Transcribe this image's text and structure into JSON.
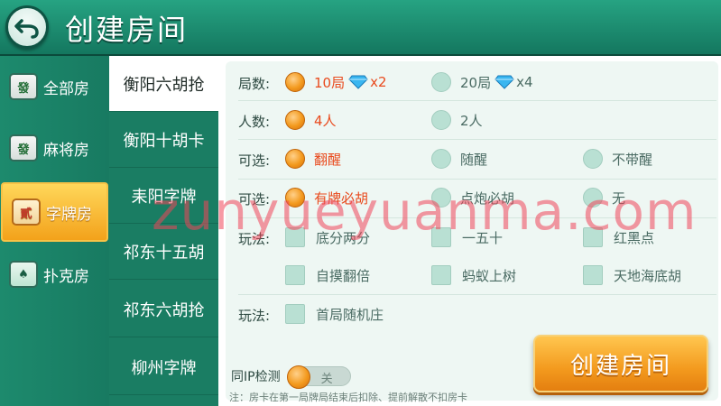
{
  "header": {
    "title": "创建房间"
  },
  "sidebar": {
    "items": [
      {
        "label": "全部房",
        "icon": "mahjong-tile-icon",
        "active": false
      },
      {
        "label": "麻将房",
        "icon": "mahjong-tile-icon",
        "active": false
      },
      {
        "label": "字牌房",
        "icon": "zipai-cards-icon",
        "active": true
      },
      {
        "label": "扑克房",
        "icon": "poker-cards-icon",
        "active": false
      }
    ]
  },
  "subtabs": [
    {
      "label": "衡阳六胡抢",
      "active": true
    },
    {
      "label": "衡阳十胡卡",
      "active": false
    },
    {
      "label": "耒阳字牌",
      "active": false
    },
    {
      "label": "祁东十五胡",
      "active": false
    },
    {
      "label": "祁东六胡抢",
      "active": false
    },
    {
      "label": "柳州字牌",
      "active": false
    }
  ],
  "options": {
    "rounds": {
      "label": "局数:",
      "choices": [
        {
          "text": "10局",
          "mult": "x2",
          "selected": true
        },
        {
          "text": "20局",
          "mult": "x4",
          "selected": false
        }
      ]
    },
    "players": {
      "label": "人数:",
      "choices": [
        {
          "text": "4人",
          "selected": true
        },
        {
          "text": "2人",
          "selected": false
        }
      ]
    },
    "optional1": {
      "label": "可选:",
      "choices": [
        {
          "text": "翻醒",
          "selected": true
        },
        {
          "text": "随醒",
          "selected": false
        },
        {
          "text": "不带醒",
          "selected": false
        }
      ]
    },
    "optional2": {
      "label": "可选:",
      "choices": [
        {
          "text": "有牌必胡",
          "selected": true
        },
        {
          "text": "点炮必胡",
          "selected": false
        },
        {
          "text": "无",
          "selected": false
        }
      ]
    },
    "play1": {
      "label": "玩法:",
      "choices": [
        {
          "text": "底分两分",
          "checked": false
        },
        {
          "text": "一五十",
          "checked": false
        },
        {
          "text": "红黑点",
          "checked": false
        },
        {
          "text": "自摸翻倍",
          "checked": false
        },
        {
          "text": "蚂蚁上树",
          "checked": false
        },
        {
          "text": "天地海底胡",
          "checked": false
        }
      ]
    },
    "play2": {
      "label": "玩法:",
      "choices": [
        {
          "text": "首局随机庄",
          "checked": false
        }
      ]
    }
  },
  "same_ip": {
    "label": "同IP检测",
    "toggle_text": "关",
    "on": false
  },
  "note": "注：房卡在第一局牌局结束后扣除、提前解散不扣房卡",
  "create_button": "创建房间",
  "watermark": "zunyueyuanma.com"
}
